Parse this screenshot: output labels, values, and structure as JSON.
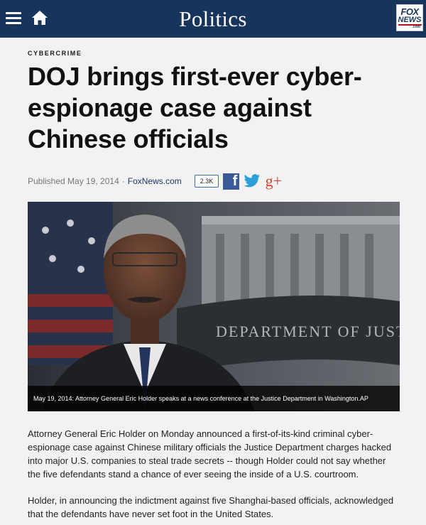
{
  "header": {
    "section_title": "Politics",
    "logo_line1": "FOX",
    "logo_line2": "NEWS",
    "logo_line3": ".com",
    "background_color": "#17345c"
  },
  "article": {
    "category": "CYBERCRIME",
    "headline": "DOJ brings first-ever cyber-espionage case against Chinese officials",
    "published_label": "Published May 19, 2014",
    "separator": "·",
    "source": "FoxNews.com",
    "share_count": "2.3K",
    "social_icons": [
      "facebook-icon",
      "twitter-icon",
      "google-plus-icon"
    ],
    "image_caption": "May 19, 2014: Attorney General Eric Holder speaks at a news conference at the Justice Department in Washington.AP",
    "image_sign_text": "DEPARTMENT OF JUSTICE",
    "paragraphs": [
      "Attorney General Eric Holder on Monday announced a first-of-its-kind criminal cyber-espionage case against Chinese military officials the Justice Department charges hacked into major U.S. companies to steal trade secrets -- though Holder could not say whether the five defendants stand a chance of ever seeing the inside of a U.S. courtroom.",
      "Holder, in announcing the indictment against five Shanghai-based officials, acknowledged that the defendants have never set foot in the United States."
    ]
  }
}
